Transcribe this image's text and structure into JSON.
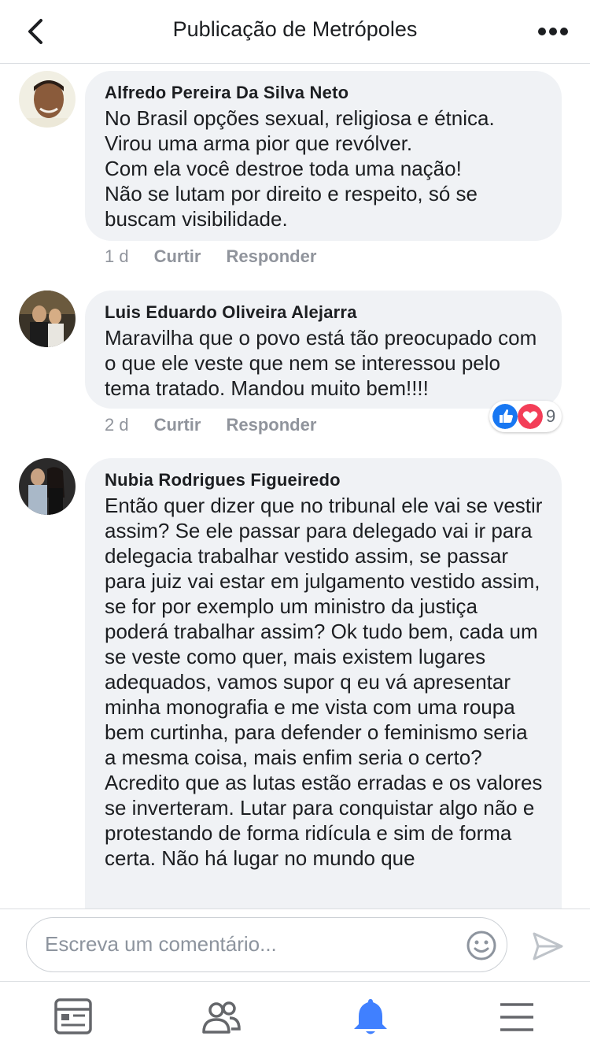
{
  "header": {
    "title": "Publicação de Metrópoles",
    "back_icon": "back-chevron-icon",
    "more_icon": "more-dots-icon"
  },
  "comments": [
    {
      "author": "Alfredo Pereira Da Silva Neto",
      "text": "No Brasil opções sexual,  religiosa e étnica.\nVirou uma arma pior que revólver.\nCom ela você destroe toda uma nação!\nNão se lutam por direito e respeito, só se buscam visibilidade.",
      "time": "1 d",
      "like_label": "Curtir",
      "reply_label": "Responder"
    },
    {
      "author": "Luis Eduardo Oliveira Alejarra",
      "text": "Maravilha que o povo está tão preocupado com o que ele veste que nem se interessou pelo tema tratado. Mandou muito bem!!!!",
      "time": "2 d",
      "like_label": "Curtir",
      "reply_label": "Responder",
      "reaction_count": "9",
      "reactions": [
        "like",
        "love"
      ]
    },
    {
      "author": "Nubia Rodrigues Figueiredo",
      "text": "Então quer dizer que no tribunal ele vai se vestir assim? Se ele passar para delegado vai ir para delegacia trabalhar vestido assim, se passar para juiz vai estar em julgamento vestido assim, se for por exemplo um ministro da justiça poderá trabalhar assim? Ok tudo bem, cada um se veste como quer, mais existem lugares adequados, vamos supor q eu vá apresentar minha monografia e me vista com uma roupa bem curtinha, para defender o feminismo seria a mesma coisa, mais enfim seria o certo? Acredito que as lutas estão erradas e os valores se inverteram. Lutar para conquistar algo não e protestando de forma ridícula e sim de forma certa. Não há lugar no mundo que"
    }
  ],
  "composer": {
    "placeholder": "Escreva um comentário...",
    "emoji_icon": "smiley-icon",
    "send_icon": "send-icon"
  },
  "tabbar": {
    "items": [
      "news-feed-icon",
      "friends-icon",
      "notifications-icon",
      "menu-icon"
    ],
    "active": "notifications-icon",
    "active_color": "#4080ff"
  },
  "colors": {
    "bubble": "#f0f2f5",
    "like": "#1877f2",
    "love": "#f33e58"
  }
}
